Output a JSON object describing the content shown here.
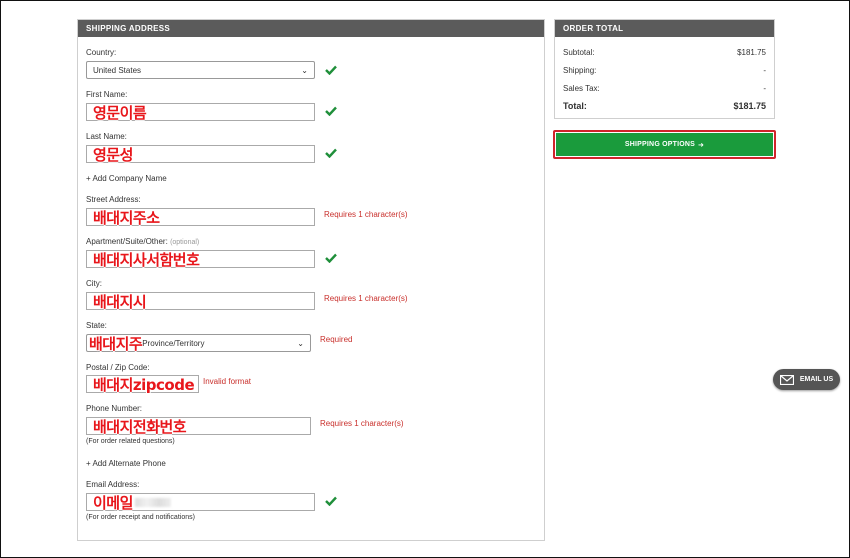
{
  "shipping": {
    "header": "SHIPPING ADDRESS",
    "country_label": "Country:",
    "country_value": "United States",
    "first_name_label": "First Name:",
    "first_name_value": "영문이름",
    "last_name_label": "Last Name:",
    "last_name_value": "영문성",
    "add_company": "+ Add Company Name",
    "street_label": "Street Address:",
    "street_value": "배대지주소",
    "street_error": "Requires 1 character(s)",
    "apt_label": "Apartment/Suite/Other:",
    "apt_optional": "(optional)",
    "apt_value": "배대지사서함번호",
    "city_label": "City:",
    "city_value": "배대지시",
    "city_error": "Requires 1 character(s)",
    "state_label": "State:",
    "state_overlay": "배대지주",
    "state_value": "Province/Territory",
    "state_error": "Required",
    "postal_label": "Postal / Zip Code:",
    "postal_value": "배대지zipcode",
    "postal_error": "Invalid format",
    "phone_label": "Phone Number:",
    "phone_value": "배대지전화번호",
    "phone_error": "Requires 1 character(s)",
    "phone_hint": "(For order related questions)",
    "add_phone": "+ Add Alternate Phone",
    "email_label": "Email Address:",
    "email_value": "이메일",
    "email_hint": "(For order receipt and notifications)"
  },
  "order": {
    "header": "ORDER TOTAL",
    "subtotal_label": "Subtotal:",
    "subtotal_value": "$181.75",
    "shipping_label": "Shipping:",
    "shipping_value": "-",
    "tax_label": "Sales Tax:",
    "tax_value": "-",
    "total_label": "Total:",
    "total_value": "$181.75"
  },
  "shipping_options_button": "SHIPPING OPTIONS",
  "email_us_button": "EMAIL US",
  "colors": {
    "check_green": "#1f8f3a",
    "error_red": "#c9302c",
    "button_green": "#1a9b3c",
    "header_gray": "#5b5b5b",
    "overlay_red": "#e8161b"
  }
}
